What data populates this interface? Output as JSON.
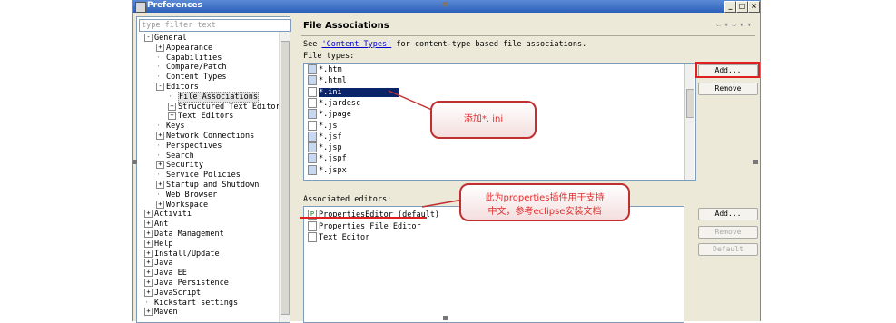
{
  "window": {
    "title": "Preferences"
  },
  "filter": {
    "placeholder": "type filter text"
  },
  "tree": [
    {
      "label": "General",
      "indent": 0,
      "exp": "-"
    },
    {
      "label": "Appearance",
      "indent": 1,
      "exp": "+"
    },
    {
      "label": "Capabilities",
      "indent": 1,
      "exp": ""
    },
    {
      "label": "Compare/Patch",
      "indent": 1,
      "exp": ""
    },
    {
      "label": "Content Types",
      "indent": 1,
      "exp": ""
    },
    {
      "label": "Editors",
      "indent": 1,
      "exp": "-"
    },
    {
      "label": "File Associations",
      "indent": 2,
      "exp": "",
      "selected": true
    },
    {
      "label": "Structured Text Editors",
      "indent": 2,
      "exp": "+"
    },
    {
      "label": "Text Editors",
      "indent": 2,
      "exp": "+"
    },
    {
      "label": "Keys",
      "indent": 1,
      "exp": ""
    },
    {
      "label": "Network Connections",
      "indent": 1,
      "exp": "+"
    },
    {
      "label": "Perspectives",
      "indent": 1,
      "exp": ""
    },
    {
      "label": "Search",
      "indent": 1,
      "exp": ""
    },
    {
      "label": "Security",
      "indent": 1,
      "exp": "+"
    },
    {
      "label": "Service Policies",
      "indent": 1,
      "exp": ""
    },
    {
      "label": "Startup and Shutdown",
      "indent": 1,
      "exp": "+"
    },
    {
      "label": "Web Browser",
      "indent": 1,
      "exp": ""
    },
    {
      "label": "Workspace",
      "indent": 1,
      "exp": "+"
    },
    {
      "label": "Activiti",
      "indent": 0,
      "exp": "+"
    },
    {
      "label": "Ant",
      "indent": 0,
      "exp": "+"
    },
    {
      "label": "Data Management",
      "indent": 0,
      "exp": "+"
    },
    {
      "label": "Help",
      "indent": 0,
      "exp": "+"
    },
    {
      "label": "Install/Update",
      "indent": 0,
      "exp": "+"
    },
    {
      "label": "Java",
      "indent": 0,
      "exp": "+"
    },
    {
      "label": "Java EE",
      "indent": 0,
      "exp": "+"
    },
    {
      "label": "Java Persistence",
      "indent": 0,
      "exp": "+"
    },
    {
      "label": "JavaScript",
      "indent": 0,
      "exp": "+"
    },
    {
      "label": "Kickstart settings",
      "indent": 0,
      "exp": ""
    },
    {
      "label": "Maven",
      "indent": 0,
      "exp": "+"
    }
  ],
  "page": {
    "title": "File Associations",
    "desc_pre": "See ",
    "desc_link": "'Content Types'",
    "desc_post": " for content-type based file associations.",
    "file_types_label": "File types:",
    "assoc_label": "Associated editors:"
  },
  "file_types": [
    {
      "label": "*.htm",
      "icon": "blue"
    },
    {
      "label": "*.html",
      "icon": "blue"
    },
    {
      "label": "*.ini",
      "icon": "white",
      "selected": true
    },
    {
      "label": "*.jardesc",
      "icon": "white"
    },
    {
      "label": "*.jpage",
      "icon": "blue"
    },
    {
      "label": "*.js",
      "icon": "white"
    },
    {
      "label": "*.jsf",
      "icon": "blue"
    },
    {
      "label": "*.jsp",
      "icon": "blue"
    },
    {
      "label": "*.jspf",
      "icon": "blue"
    },
    {
      "label": "*.jspx",
      "icon": "blue"
    }
  ],
  "editors": [
    {
      "label": "PropertiesEditor (default)",
      "icon": "P"
    },
    {
      "label": "Properties File Editor",
      "icon": ""
    },
    {
      "label": "Text Editor",
      "icon": ""
    }
  ],
  "buttons": {
    "add_types": "Add...",
    "remove_types": "Remove",
    "add_editor": "Add...",
    "remove_editor": "Remove",
    "default_editor": "Default"
  },
  "annotations": {
    "callout1": "添加*. ini",
    "callout2_line1": "此为properties插件用于支持",
    "callout2_line2": "中文，参考eclipse安装文档"
  },
  "colors": {
    "selection": "#0a246a",
    "annotation_red": "#e02020"
  }
}
